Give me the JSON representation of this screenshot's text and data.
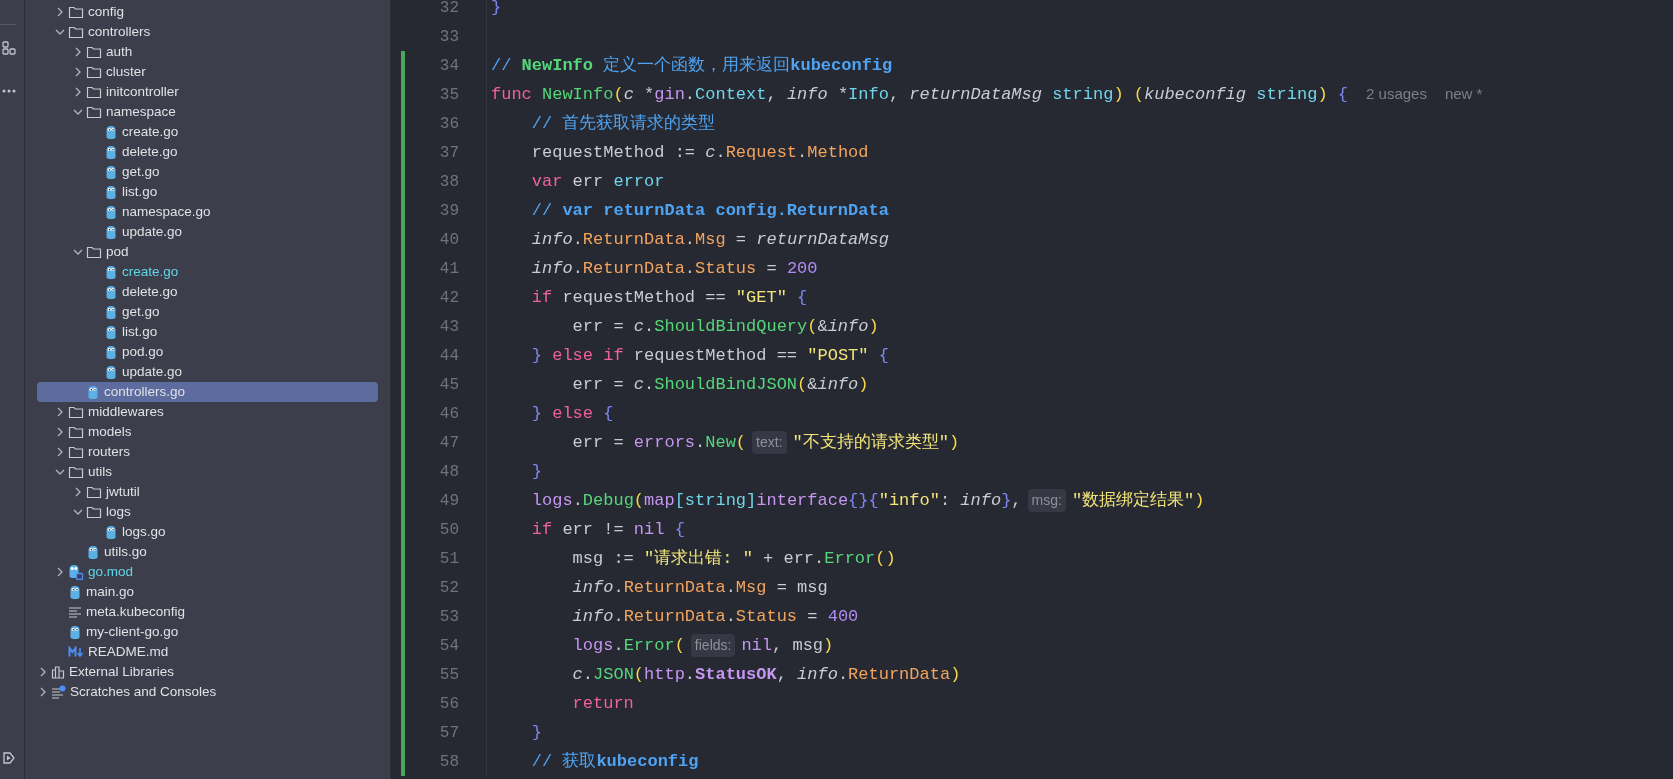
{
  "project_items": [
    {
      "label": "config",
      "kind": "folder",
      "expanded": false,
      "selected": false
    },
    {
      "label": "controllers",
      "kind": "folder",
      "expanded": true,
      "selected": false,
      "children": [
        {
          "label": "auth",
          "kind": "folder",
          "expanded": false,
          "selected": false
        },
        {
          "label": "cluster",
          "kind": "folder",
          "expanded": false,
          "selected": false
        },
        {
          "label": "initcontroller",
          "kind": "folder",
          "expanded": false,
          "selected": false
        },
        {
          "label": "namespace",
          "kind": "folder",
          "expanded": true,
          "selected": false,
          "children": [
            {
              "label": "create.go",
              "kind": "go",
              "selected": false
            },
            {
              "label": "delete.go",
              "kind": "go",
              "selected": false
            },
            {
              "label": "get.go",
              "kind": "go",
              "selected": false
            },
            {
              "label": "list.go",
              "kind": "go",
              "selected": false
            },
            {
              "label": "namespace.go",
              "kind": "go",
              "selected": false
            },
            {
              "label": "update.go",
              "kind": "go",
              "selected": false
            }
          ]
        },
        {
          "label": "pod",
          "kind": "folder",
          "expanded": true,
          "selected": false,
          "children": [
            {
              "label": "create.go",
              "kind": "go",
              "selected": false,
              "color": "#62d6e8"
            },
            {
              "label": "delete.go",
              "kind": "go",
              "selected": false
            },
            {
              "label": "get.go",
              "kind": "go",
              "selected": false
            },
            {
              "label": "list.go",
              "kind": "go",
              "selected": false
            },
            {
              "label": "pod.go",
              "kind": "go",
              "selected": false
            },
            {
              "label": "update.go",
              "kind": "go",
              "selected": false
            }
          ]
        },
        {
          "label": "controllers.go",
          "kind": "go",
          "selected": true
        }
      ]
    },
    {
      "label": "middlewares",
      "kind": "folder",
      "expanded": false,
      "selected": false
    },
    {
      "label": "models",
      "kind": "folder",
      "expanded": false,
      "selected": false
    },
    {
      "label": "routers",
      "kind": "folder",
      "expanded": false,
      "selected": false
    },
    {
      "label": "utils",
      "kind": "folder",
      "expanded": true,
      "selected": false,
      "children": [
        {
          "label": "jwtutil",
          "kind": "folder",
          "expanded": false,
          "selected": false
        },
        {
          "label": "logs",
          "kind": "folder",
          "expanded": true,
          "selected": false,
          "children": [
            {
              "label": "logs.go",
              "kind": "go",
              "selected": false
            }
          ]
        },
        {
          "label": "utils.go",
          "kind": "go",
          "selected": false
        }
      ]
    },
    {
      "label": "go.mod",
      "kind": "gomod",
      "expanded": false,
      "selected": false,
      "color": "#62d6e8"
    },
    {
      "label": "main.go",
      "kind": "go",
      "selected": false
    },
    {
      "label": "meta.kubeconfig",
      "kind": "text",
      "selected": false
    },
    {
      "label": "my-client-go.go",
      "kind": "go",
      "selected": false
    },
    {
      "label": "README.md",
      "kind": "markdown",
      "selected": false
    }
  ],
  "top_items": [
    {
      "label": "External Libraries",
      "kind": "library",
      "expanded": false,
      "selected": false
    },
    {
      "label": "Scratches and Consoles",
      "kind": "scratches",
      "expanded": false,
      "selected": false
    }
  ],
  "code_lines": [
    {
      "number": "32",
      "changed": false,
      "parts": [
        {
          "kind": "code",
          "tokens": [
            {
              "kind": "brace",
              "text": "}"
            }
          ]
        }
      ]
    },
    {
      "number": "33",
      "changed": false
    },
    {
      "number": "34",
      "changed": true,
      "parts": [
        {
          "kind": "code",
          "tokens": [
            {
              "kind": "comment",
              "text": "// "
            },
            {
              "kind": "cfn",
              "text": "NewInfo"
            },
            {
              "kind": "comment",
              "text": " 定义一个函数，用来返回"
            },
            {
              "kind": "cref",
              "text": "kubeconfig"
            }
          ]
        }
      ]
    },
    {
      "number": "35",
      "changed": true,
      "parts": [
        {
          "kind": "code",
          "tokens": [
            {
              "kind": "kw",
              "text": "func "
            },
            {
              "kind": "fn",
              "text": "NewInfo"
            },
            {
              "kind": "paren",
              "text": "("
            },
            {
              "kind": "param",
              "text": "c"
            },
            {
              "kind": "plain",
              "text": " *"
            },
            {
              "kind": "pkg",
              "text": "gin"
            },
            {
              "kind": "plain",
              "text": "."
            },
            {
              "kind": "type",
              "text": "Context"
            },
            {
              "kind": "plain",
              "text": ", "
            },
            {
              "kind": "param",
              "text": "info"
            },
            {
              "kind": "plain",
              "text": " *"
            },
            {
              "kind": "type",
              "text": "Info"
            },
            {
              "kind": "plain",
              "text": ", "
            },
            {
              "kind": "param",
              "text": "returnDataMsg "
            },
            {
              "kind": "type",
              "text": "string"
            },
            {
              "kind": "paren",
              "text": ") ("
            },
            {
              "kind": "param",
              "text": "kubeconfig "
            },
            {
              "kind": "type",
              "text": "string"
            },
            {
              "kind": "paren",
              "text": ") "
            },
            {
              "kind": "brace",
              "text": "{"
            }
          ]
        },
        {
          "kind": "lens",
          "text": "2 usages"
        },
        {
          "kind": "lens",
          "text": "new *"
        }
      ]
    },
    {
      "number": "36",
      "changed": true,
      "parts": [
        {
          "kind": "code",
          "tokens": [
            {
              "kind": "comment",
              "text": "    // 首先获取请求的类型"
            }
          ]
        }
      ]
    },
    {
      "number": "37",
      "changed": true,
      "parts": [
        {
          "kind": "code",
          "tokens": [
            {
              "kind": "plain",
              "text": "    requestMethod := "
            },
            {
              "kind": "param",
              "text": "c"
            },
            {
              "kind": "plain",
              "text": "."
            },
            {
              "kind": "field",
              "text": "Request"
            },
            {
              "kind": "plain",
              "text": "."
            },
            {
              "kind": "field",
              "text": "Method"
            }
          ]
        }
      ]
    },
    {
      "number": "38",
      "changed": true,
      "parts": [
        {
          "kind": "code",
          "tokens": [
            {
              "kind": "kw",
              "text": "    var"
            },
            {
              "kind": "plain",
              "text": " err "
            },
            {
              "kind": "type",
              "text": "error"
            }
          ]
        }
      ]
    },
    {
      "number": "39",
      "changed": true,
      "parts": [
        {
          "kind": "code",
          "tokens": [
            {
              "kind": "comment",
              "text": "    // "
            },
            {
              "kind": "cref",
              "text": "var returnData config.ReturnData"
            }
          ]
        }
      ]
    },
    {
      "number": "40",
      "changed": true,
      "parts": [
        {
          "kind": "code",
          "tokens": [
            {
              "kind": "param",
              "text": "    info"
            },
            {
              "kind": "plain",
              "text": "."
            },
            {
              "kind": "field",
              "text": "ReturnData"
            },
            {
              "kind": "plain",
              "text": "."
            },
            {
              "kind": "field",
              "text": "Msg"
            },
            {
              "kind": "plain",
              "text": " = "
            },
            {
              "kind": "param",
              "text": "returnDataMsg"
            }
          ]
        }
      ]
    },
    {
      "number": "41",
      "changed": true,
      "parts": [
        {
          "kind": "code",
          "tokens": [
            {
              "kind": "param",
              "text": "    info"
            },
            {
              "kind": "plain",
              "text": "."
            },
            {
              "kind": "field",
              "text": "ReturnData"
            },
            {
              "kind": "plain",
              "text": "."
            },
            {
              "kind": "field",
              "text": "Status"
            },
            {
              "kind": "plain",
              "text": " = "
            },
            {
              "kind": "num",
              "text": "200"
            }
          ]
        }
      ]
    },
    {
      "number": "42",
      "changed": true,
      "parts": [
        {
          "kind": "code",
          "tokens": [
            {
              "kind": "kw",
              "text": "    if"
            },
            {
              "kind": "plain",
              "text": " requestMethod == "
            },
            {
              "kind": "str",
              "text": "\"GET\" "
            },
            {
              "kind": "brace",
              "text": "{"
            }
          ]
        }
      ]
    },
    {
      "number": "43",
      "changed": true,
      "parts": [
        {
          "kind": "code",
          "tokens": [
            {
              "kind": "plain",
              "text": "        err = "
            },
            {
              "kind": "param",
              "text": "c"
            },
            {
              "kind": "plain",
              "text": "."
            },
            {
              "kind": "fn",
              "text": "ShouldBindQuery"
            },
            {
              "kind": "paren",
              "text": "("
            },
            {
              "kind": "plain",
              "text": "&"
            },
            {
              "kind": "param",
              "text": "info"
            },
            {
              "kind": "paren",
              "text": ")"
            }
          ]
        }
      ]
    },
    {
      "number": "44",
      "changed": true,
      "parts": [
        {
          "kind": "code",
          "tokens": [
            {
              "kind": "brace",
              "text": "    } "
            },
            {
              "kind": "kw",
              "text": "else if"
            },
            {
              "kind": "plain",
              "text": " requestMethod == "
            },
            {
              "kind": "str",
              "text": "\"POST\" "
            },
            {
              "kind": "brace",
              "text": "{"
            }
          ]
        }
      ]
    },
    {
      "number": "45",
      "changed": true,
      "parts": [
        {
          "kind": "code",
          "tokens": [
            {
              "kind": "plain",
              "text": "        err = "
            },
            {
              "kind": "param",
              "text": "c"
            },
            {
              "kind": "plain",
              "text": "."
            },
            {
              "kind": "fn",
              "text": "ShouldBindJSON"
            },
            {
              "kind": "paren",
              "text": "("
            },
            {
              "kind": "plain",
              "text": "&"
            },
            {
              "kind": "param",
              "text": "info"
            },
            {
              "kind": "paren",
              "text": ")"
            }
          ]
        }
      ]
    },
    {
      "number": "46",
      "changed": true,
      "parts": [
        {
          "kind": "code",
          "tokens": [
            {
              "kind": "brace",
              "text": "    } "
            },
            {
              "kind": "kw",
              "text": "else "
            },
            {
              "kind": "brace",
              "text": "{"
            }
          ]
        }
      ]
    },
    {
      "number": "47",
      "changed": true,
      "parts": [
        {
          "kind": "code",
          "tokens": [
            {
              "kind": "plain",
              "text": "        err = "
            },
            {
              "kind": "pkg",
              "text": "errors"
            },
            {
              "kind": "plain",
              "text": "."
            },
            {
              "kind": "fn",
              "text": "New"
            },
            {
              "kind": "paren",
              "text": "("
            }
          ]
        },
        {
          "kind": "hint",
          "text": "text:"
        },
        {
          "kind": "code",
          "tokens": [
            {
              "kind": "str",
              "text": "\"不支持的请求类型\""
            },
            {
              "kind": "paren",
              "text": ")"
            }
          ]
        }
      ]
    },
    {
      "number": "48",
      "changed": true,
      "parts": [
        {
          "kind": "code",
          "tokens": [
            {
              "kind": "brace",
              "text": "    }"
            }
          ]
        }
      ]
    },
    {
      "number": "49",
      "changed": true,
      "parts": [
        {
          "kind": "code",
          "tokens": [
            {
              "kind": "pkg",
              "text": "    logs"
            },
            {
              "kind": "plain",
              "text": "."
            },
            {
              "kind": "fn",
              "text": "Debug"
            },
            {
              "kind": "paren",
              "text": "("
            },
            {
              "kind": "pkg",
              "text": "map"
            },
            {
              "kind": "square",
              "text": "["
            },
            {
              "kind": "type",
              "text": "string"
            },
            {
              "kind": "square",
              "text": "]"
            },
            {
              "kind": "pkg",
              "text": "interface"
            },
            {
              "kind": "brace",
              "text": "{}{"
            },
            {
              "kind": "str",
              "text": "\"info\""
            },
            {
              "kind": "plain",
              "text": ": "
            },
            {
              "kind": "param",
              "text": "info"
            },
            {
              "kind": "brace",
              "text": "}"
            },
            {
              "kind": "plain",
              "text": ","
            }
          ]
        },
        {
          "kind": "hint",
          "text": "msg:"
        },
        {
          "kind": "code",
          "tokens": [
            {
              "kind": "str",
              "text": "\"数据绑定结果\""
            },
            {
              "kind": "paren",
              "text": ")"
            }
          ]
        }
      ]
    },
    {
      "number": "50",
      "changed": true,
      "parts": [
        {
          "kind": "code",
          "tokens": [
            {
              "kind": "kw",
              "text": "    if"
            },
            {
              "kind": "plain",
              "text": " err != "
            },
            {
              "kind": "pkg",
              "text": "nil "
            },
            {
              "kind": "brace",
              "text": "{"
            }
          ]
        }
      ]
    },
    {
      "number": "51",
      "changed": true,
      "parts": [
        {
          "kind": "code",
          "tokens": [
            {
              "kind": "plain",
              "text": "        msg := "
            },
            {
              "kind": "str",
              "text": "\"请求出错: \""
            },
            {
              "kind": "plain",
              "text": " + err."
            },
            {
              "kind": "fn",
              "text": "Error"
            },
            {
              "kind": "paren",
              "text": "()"
            }
          ]
        }
      ]
    },
    {
      "number": "52",
      "changed": true,
      "parts": [
        {
          "kind": "code",
          "tokens": [
            {
              "kind": "param",
              "text": "        info"
            },
            {
              "kind": "plain",
              "text": "."
            },
            {
              "kind": "field",
              "text": "ReturnData"
            },
            {
              "kind": "plain",
              "text": "."
            },
            {
              "kind": "field",
              "text": "Msg"
            },
            {
              "kind": "plain",
              "text": " = msg"
            }
          ]
        }
      ]
    },
    {
      "number": "53",
      "changed": true,
      "parts": [
        {
          "kind": "code",
          "tokens": [
            {
              "kind": "param",
              "text": "        info"
            },
            {
              "kind": "plain",
              "text": "."
            },
            {
              "kind": "field",
              "text": "ReturnData"
            },
            {
              "kind": "plain",
              "text": "."
            },
            {
              "kind": "field",
              "text": "Status"
            },
            {
              "kind": "plain",
              "text": " = "
            },
            {
              "kind": "num",
              "text": "400"
            }
          ]
        }
      ]
    },
    {
      "number": "54",
      "changed": true,
      "parts": [
        {
          "kind": "code",
          "tokens": [
            {
              "kind": "pkg",
              "text": "        logs"
            },
            {
              "kind": "plain",
              "text": "."
            },
            {
              "kind": "fn",
              "text": "Error"
            },
            {
              "kind": "paren",
              "text": "("
            }
          ]
        },
        {
          "kind": "hint",
          "text": "fields:"
        },
        {
          "kind": "code",
          "tokens": [
            {
              "kind": "pkg",
              "text": "nil"
            },
            {
              "kind": "plain",
              "text": ", msg"
            },
            {
              "kind": "paren",
              "text": ")"
            }
          ]
        }
      ]
    },
    {
      "number": "55",
      "changed": true,
      "parts": [
        {
          "kind": "code",
          "tokens": [
            {
              "kind": "param",
              "text": "        c"
            },
            {
              "kind": "plain",
              "text": "."
            },
            {
              "kind": "fn",
              "text": "JSON"
            },
            {
              "kind": "paren",
              "text": "("
            },
            {
              "kind": "pkg",
              "text": "http"
            },
            {
              "kind": "plain",
              "text": "."
            },
            {
              "kind": "const",
              "text": "StatusOK"
            },
            {
              "kind": "plain",
              "text": ", "
            },
            {
              "kind": "param",
              "text": "info"
            },
            {
              "kind": "plain",
              "text": "."
            },
            {
              "kind": "field",
              "text": "ReturnData"
            },
            {
              "kind": "paren",
              "text": ")"
            }
          ]
        }
      ]
    },
    {
      "number": "56",
      "changed": true,
      "parts": [
        {
          "kind": "code",
          "tokens": [
            {
              "kind": "kw",
              "text": "        return"
            }
          ]
        }
      ]
    },
    {
      "number": "57",
      "changed": true,
      "parts": [
        {
          "kind": "code",
          "tokens": [
            {
              "kind": "brace",
              "text": "    }"
            }
          ]
        }
      ]
    },
    {
      "number": "58",
      "changed": true,
      "parts": [
        {
          "kind": "code",
          "tokens": [
            {
              "kind": "comment",
              "text": "    // 获取"
            },
            {
              "kind": "cref",
              "text": "kubeconfig"
            }
          ]
        }
      ]
    }
  ]
}
